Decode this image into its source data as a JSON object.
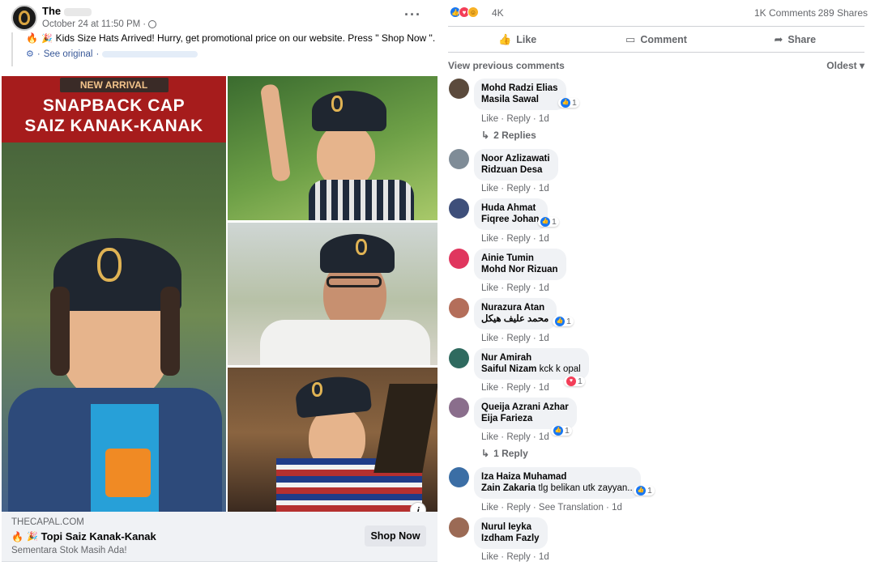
{
  "post": {
    "page_name": "The",
    "timestamp": "October 24 at 11:50 PM",
    "meta_sep": "·",
    "text": "Kids Size Hats Arrived! Hurry, get promotional price on our website. Press \" Shop Now \".",
    "see_original": "See original",
    "more_icon": "more-horizontal-icon",
    "banner": {
      "tag": "NEW ARRIVAL",
      "line1": "SNAPBACK CAP",
      "line2": "SAIZ KANAK-KANAK"
    },
    "link": {
      "domain": "THECAPAL.COM",
      "title": "Topi Saiz Kanak-Kanak",
      "description": "Sementara Stok Masih Ada!",
      "cta": "Shop Now"
    },
    "info_glyph": "i"
  },
  "engagement": {
    "reactions": "4K",
    "comments": "1K Comments",
    "shares": "289 Shares",
    "actions": {
      "like": "Like",
      "comment": "Comment",
      "share": "Share"
    },
    "view_previous": "View previous comments",
    "sort": "Oldest"
  },
  "comments": [
    {
      "name": "Mohd Radzi Elias",
      "tag": "Masila Sawal",
      "text": "",
      "react": "1",
      "react_type": "like",
      "actions": "Like · Reply · 1d",
      "replies": "2 Replies",
      "avatar_color": "#5b4a3c"
    },
    {
      "name": "Noor Azlizawati",
      "tag": "Ridzuan Desa",
      "text": "",
      "react": "",
      "react_type": "",
      "actions": "Like · Reply · 1d",
      "replies": "",
      "avatar_color": "#7f8c97"
    },
    {
      "name": "Huda Ahmat",
      "tag": "Fiqree Johan",
      "text": "",
      "react": "1",
      "react_type": "like",
      "actions": "Like · Reply · 1d",
      "replies": "",
      "avatar_color": "#3e4f7a"
    },
    {
      "name": "Ainie Tumin",
      "tag": "Mohd Nor Rizuan",
      "text": "",
      "react": "",
      "react_type": "",
      "actions": "Like · Reply · 1d",
      "replies": "",
      "avatar_color": "#e0365e"
    },
    {
      "name": "Nurazura Atan",
      "tag": "محمد عليف هيكل",
      "text": "",
      "react": "1",
      "react_type": "like",
      "actions": "Like · Reply · 1d",
      "replies": "",
      "avatar_color": "#b46e5a"
    },
    {
      "name": "Nur Amirah",
      "tag": "Saiful Nizam",
      "text": "kck k opal",
      "react": "1",
      "react_type": "love",
      "actions": "Like · Reply · 1d",
      "replies": "",
      "avatar_color": "#2f6a5f"
    },
    {
      "name": "Queija Azrani Azhar",
      "tag": "Eija Farieza",
      "text": "",
      "react": "1",
      "react_type": "like",
      "actions": "Like · Reply · 1d",
      "replies": "1 Reply",
      "avatar_color": "#8a6e8c"
    },
    {
      "name": "Iza Haiza Muhamad",
      "tag": "Zain Zakaria",
      "text": "tlg belikan utk zayyan..",
      "react": "1",
      "react_type": "like",
      "actions": "Like · Reply · See Translation · 1d",
      "replies": "",
      "avatar_color": "#3b6ea5"
    },
    {
      "name": "Nurul Ieyka",
      "tag": "Izdham Fazly",
      "text": "",
      "react": "",
      "react_type": "",
      "actions": "Like · Reply · 1d",
      "replies": "",
      "avatar_color": "#9b6a55"
    }
  ]
}
